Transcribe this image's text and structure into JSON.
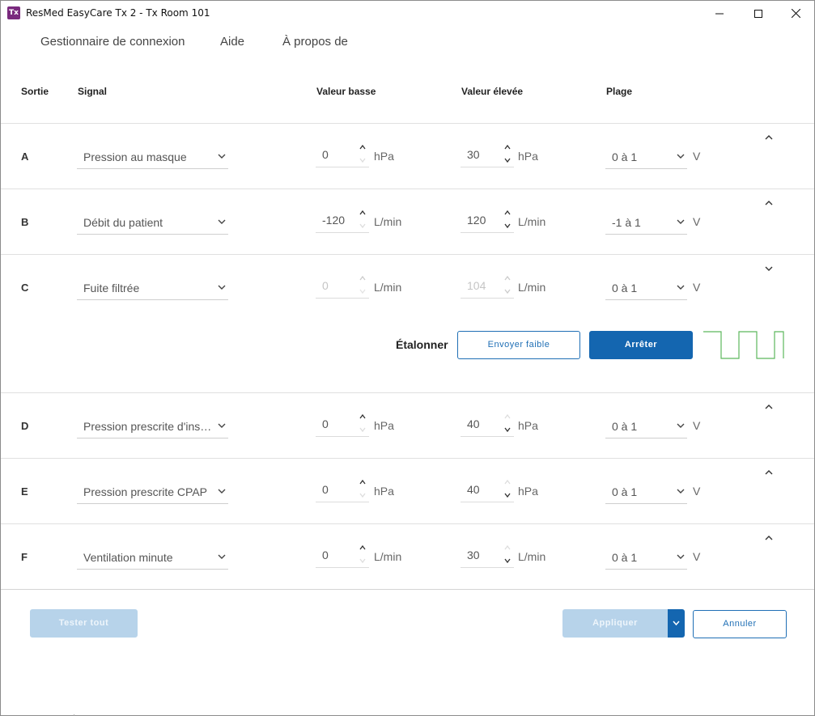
{
  "window": {
    "icon_text": "Tx",
    "title": "ResMed EasyCare Tx 2 - Tx Room 101"
  },
  "menu": {
    "items": [
      "Gestionnaire de connexion",
      "Aide",
      "À propos de"
    ]
  },
  "table": {
    "headers": {
      "output": "Sortie",
      "signal": "Signal",
      "low": "Valeur basse",
      "high": "Valeur élevée",
      "range": "Plage"
    },
    "rows": [
      {
        "letter": "A",
        "signal": "Pression au masque",
        "low": "0",
        "low_unit": "hPa",
        "high": "30",
        "high_unit": "hPa",
        "range": "0 à 1",
        "range_unit": "V",
        "low_disabled": false,
        "high_disabled": false,
        "expanded": false
      },
      {
        "letter": "B",
        "signal": "Débit du patient",
        "low": "-120",
        "low_unit": "L/min",
        "high": "120",
        "high_unit": "L/min",
        "range": "-1 à 1",
        "range_unit": "V",
        "low_disabled": false,
        "high_disabled": false,
        "expanded": false
      },
      {
        "letter": "C",
        "signal": "Fuite filtrée",
        "low": "0",
        "low_unit": "L/min",
        "high": "104",
        "high_unit": "L/min",
        "range": "0 à 1",
        "range_unit": "V",
        "low_disabled": true,
        "high_disabled": true,
        "expanded": true
      },
      {
        "letter": "D",
        "signal": "Pression prescrite d'insp…",
        "low": "0",
        "low_unit": "hPa",
        "high": "40",
        "high_unit": "hPa",
        "range": "0 à 1",
        "range_unit": "V",
        "low_disabled": false,
        "high_disabled": false,
        "expanded": false
      },
      {
        "letter": "E",
        "signal": "Pression prescrite CPAP",
        "low": "0",
        "low_unit": "hPa",
        "high": "40",
        "high_unit": "hPa",
        "range": "0 à 1",
        "range_unit": "V",
        "low_disabled": false,
        "high_disabled": false,
        "expanded": false
      },
      {
        "letter": "F",
        "signal": "Ventilation minute",
        "low": "0",
        "low_unit": "L/min",
        "high": "30",
        "high_unit": "L/min",
        "range": "0 à 1",
        "range_unit": "V",
        "low_disabled": false,
        "high_disabled": false,
        "expanded": false
      }
    ]
  },
  "calibration": {
    "label": "Étalonner",
    "send_low": "Envoyer faible",
    "stop": "Arrêter"
  },
  "footer": {
    "test_all": "Tester tout",
    "apply": "Appliquer",
    "cancel": "Annuler"
  },
  "colors": {
    "accent": "#1466b0",
    "accent_disabled": "#b7d3ea",
    "waveform": "#5cb85c",
    "app_icon": "#7a2a7e"
  }
}
